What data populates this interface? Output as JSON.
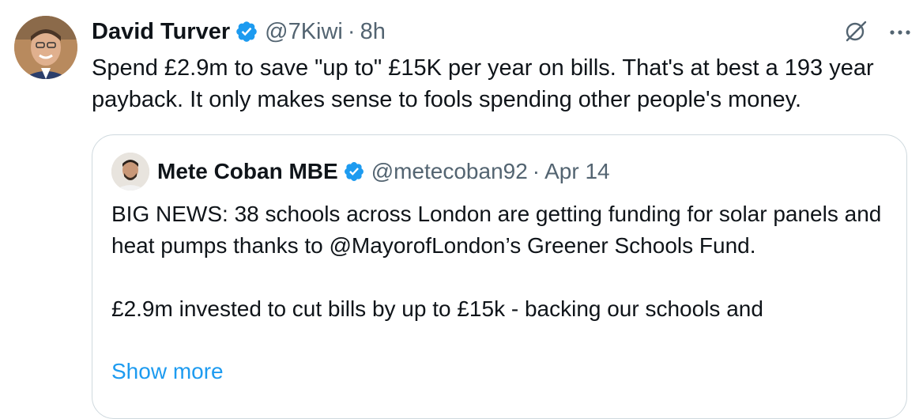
{
  "tweet": {
    "author_name": "David Turver",
    "handle": "@7Kiwi",
    "separator": "·",
    "time": "8h",
    "text": "Spend £2.9m to save \"up to\" £15K per year on bills. That's at best a 193 year payback. It only makes sense to fools spending other people's money.",
    "more_options_label": "···"
  },
  "quoted_tweet": {
    "author_name": "Mete Coban MBE",
    "handle": "@metecoban92",
    "separator": "·",
    "date": "Apr 14",
    "paragraph_1": "BIG NEWS: 38 schools across London are getting funding for solar panels and heat pumps thanks to @MayorofLondon’s Greener Schools Fund.",
    "paragraph_2": "£2.9m invested to cut bills by up to £15k - backing our schools and",
    "show_more_label": "Show more"
  },
  "colors": {
    "text_primary": "#0f1419",
    "text_secondary": "#536471",
    "accent": "#1d9bf0",
    "border": "#cfd9de"
  },
  "icons": [
    "verified-badge-icon",
    "grok-icon",
    "more-options-icon"
  ]
}
